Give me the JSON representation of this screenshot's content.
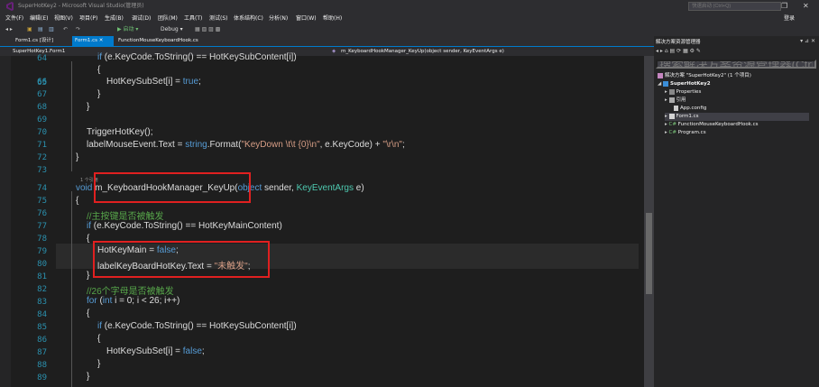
{
  "window": {
    "title": "SuperHotKey2 - Microsoft Visual Studio(管理员)",
    "controls": [
      "▫",
      "—",
      "❐",
      "✕"
    ]
  },
  "menu": [
    "文件(F)",
    "编辑(E)",
    "视图(V)",
    "项目(P)",
    "生成(B)",
    "调试(D)",
    "团队(M)",
    "工具(T)",
    "测试(S)",
    "体系结构(C)",
    "分析(N)",
    "窗口(W)",
    "帮助(H)"
  ],
  "quick_launch": {
    "placeholder": "快速启动 (Ctrl+Q)"
  },
  "login": "登录",
  "toolbar": {
    "start": "▶ 启动 ▾",
    "config": "Debug ▾"
  },
  "tabs": [
    {
      "label": "Form1.cs [设计]"
    },
    {
      "label": "Form1.cs ✕",
      "active": true
    },
    {
      "label": "FunctionMouseKeyboardHook.cs"
    }
  ],
  "nav": {
    "left": "SuperHotKey1.Form1",
    "right": "m_KeyboardHookManager_KeyUp(object sender, KeyEventArgs e)"
  },
  "editor": {
    "refs_label": "1 个引用",
    "lines": [
      {
        "n": "64",
        "code": "if (e.KeyCode.ToString() == HotKeySubContent[i])"
      },
      {
        "n": "65",
        "code": "{"
      },
      {
        "n": "66",
        "code": "HotKeySubSet[i] = true;"
      },
      {
        "n": "67",
        "code": "}"
      },
      {
        "n": "68",
        "code": "}"
      },
      {
        "n": "69",
        "code": ""
      },
      {
        "n": "70",
        "code": "TriggerHotKey();"
      },
      {
        "n": "71",
        "code": "labelMouseEvent.Text = string.Format(\"KeyDown \\t\\t {0}\\n\", e.KeyCode) + \"\\r\\n\";"
      },
      {
        "n": "72",
        "code": "}"
      },
      {
        "n": "73",
        "code": ""
      },
      {
        "n": "74",
        "code": "void m_KeyboardHookManager_KeyUp(object sender, KeyEventArgs e)"
      },
      {
        "n": "75",
        "code": "{"
      },
      {
        "n": "76",
        "code": "//主按键是否被触发"
      },
      {
        "n": "77",
        "code": "if (e.KeyCode.ToString() == HotKeyMainContent)"
      },
      {
        "n": "78",
        "code": "{"
      },
      {
        "n": "79",
        "code": "HotKeyMain = false;"
      },
      {
        "n": "80",
        "code": "labelKeyBoardHotKey.Text = \"未触发\";"
      },
      {
        "n": "81",
        "code": "}"
      },
      {
        "n": "82",
        "code": "//26个字母是否被触发"
      },
      {
        "n": "83",
        "code": "for (int i = 0; i < 26; i++)"
      },
      {
        "n": "84",
        "code": "{"
      },
      {
        "n": "85",
        "code": "if (e.KeyCode.ToString() == HotKeySubContent[i])"
      },
      {
        "n": "86",
        "code": "{"
      },
      {
        "n": "87",
        "code": "HotKeySubSet[i] = false;"
      },
      {
        "n": "88",
        "code": "}"
      },
      {
        "n": "89",
        "code": "}"
      }
    ]
  },
  "solution_explorer": {
    "header": "解决方案资源管理器",
    "search_placeholder": "搜索解决方案资源管理器(Ctrl+;)",
    "items": [
      {
        "label": "解决方案 \"SuperHotKey2\" (1 个项目)"
      },
      {
        "label": "SuperHotKey2"
      },
      {
        "label": "Properties"
      },
      {
        "label": "引用"
      },
      {
        "label": "App.config"
      },
      {
        "label": "Form1.cs"
      },
      {
        "label": "FunctionMouseKeyboardHook.cs"
      },
      {
        "label": "Program.cs"
      }
    ]
  },
  "colors": {
    "accent": "#007acc",
    "highlight_box": "#e02020",
    "keyword": "#569cd6",
    "type": "#4ec9b0",
    "string": "#d69d85",
    "comment": "#57a64a"
  }
}
